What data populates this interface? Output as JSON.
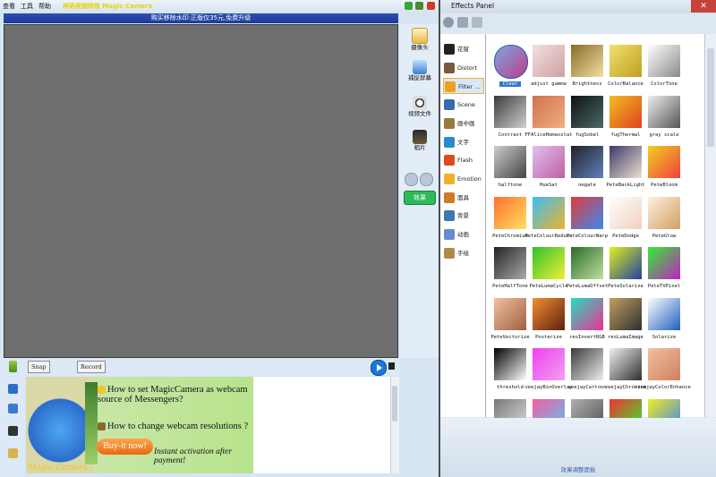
{
  "menu": {
    "items": [
      "查看",
      "工具",
      "帮助"
    ],
    "app_title": "神奇视频特效 Magic Camera"
  },
  "banner": {
    "text": "购买移除水印:正版仅35元,免费升级"
  },
  "side_tools": [
    {
      "label": "摄像头",
      "icon": "camera-icon"
    },
    {
      "label": "捕捉屏幕",
      "icon": "screen-capture-icon"
    },
    {
      "label": "视频文件",
      "icon": "video-file-icon"
    },
    {
      "label": "相片",
      "icon": "photo-icon"
    }
  ],
  "effects_button": "效果",
  "controls": {
    "snap": "Snap",
    "record": "Record"
  },
  "ad": {
    "line1": "How to set MagicCamera as webcam source of Messengers?",
    "line2": "How to change webcam resolutions ?",
    "buy": "Buy-it now!",
    "instant": "Instant activation after payment!",
    "logo": "Magic Camera"
  },
  "panel": {
    "title": "Effects Panel",
    "close": "✕",
    "footer": "效果调整面板",
    "categories": [
      "花窗",
      "Distort",
      "Filter ...",
      "Scene",
      "画中画",
      "文字",
      "Flash",
      "Emotion",
      "面具",
      "背景",
      "动画",
      "手绘"
    ],
    "selected_category": "Filter ...",
    "effects": [
      "Clear",
      "adjust gamma",
      "Brightness",
      "ColorBalance",
      "ColorTone",
      "Contrast",
      "FFAliceHomeostat",
      "fugSobel",
      "fugThermal",
      "gray scale",
      "halftone",
      "HueSat",
      "negate",
      "PeteBackLight",
      "PeteBloom",
      "PeteChromium",
      "PeteColourReduce",
      "PeteColourWarp",
      "PeteDodge",
      "PeteGlow",
      "PeteHalfTone",
      "PeteLumaCycle",
      "PeteLumaOffset",
      "PeteSolarize",
      "PeteTVPixel",
      "PeteVectorize",
      "Posterize",
      "resInvertRGB",
      "resLumaImage",
      "Solarize",
      "threshold",
      "veejayBinOverlay",
      "veejayCartoon",
      "veejayChromium",
      "veejayColorEnhance",
      "",
      "",
      "",
      "",
      ""
    ],
    "selected_effect": "Clear"
  }
}
